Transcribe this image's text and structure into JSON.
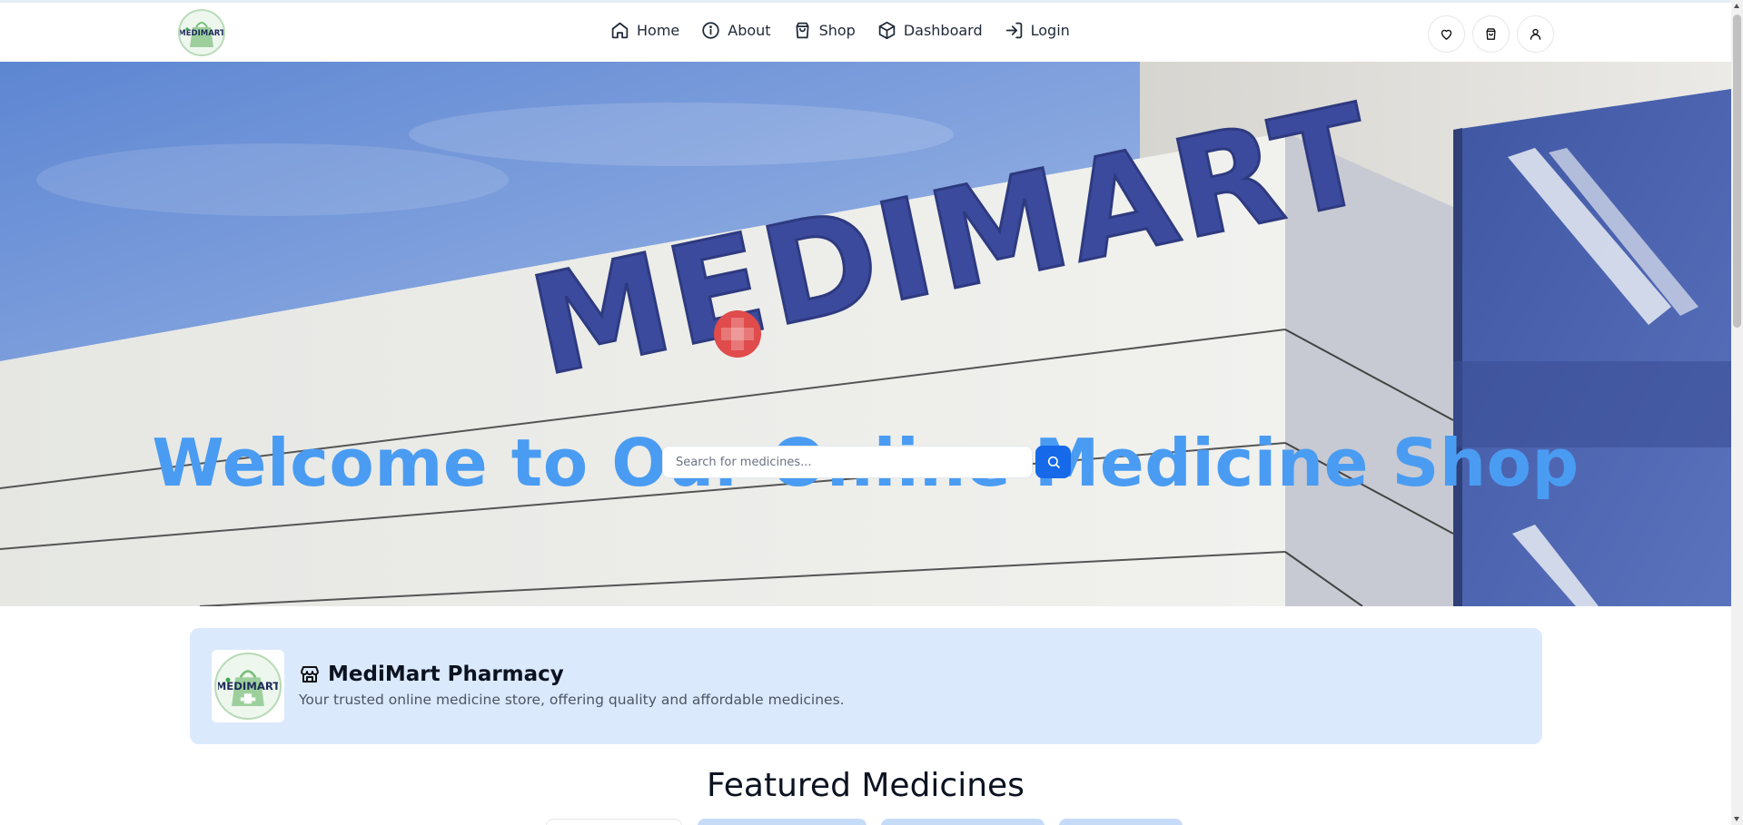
{
  "brand": {
    "logo_text": "MEDIMART",
    "logo_accent": "#3aaa48",
    "logo_dark": "#1d2b5a"
  },
  "nav": {
    "links": [
      {
        "label": "Home",
        "icon": "home-icon"
      },
      {
        "label": "About",
        "icon": "info-icon"
      },
      {
        "label": "Shop",
        "icon": "shopping-bag-icon"
      },
      {
        "label": "Dashboard",
        "icon": "package-icon"
      },
      {
        "label": "Login",
        "icon": "login-icon"
      }
    ],
    "actions": [
      {
        "icon": "heart-icon"
      },
      {
        "icon": "cart-icon"
      },
      {
        "icon": "user-icon"
      }
    ]
  },
  "hero": {
    "signage_text": "MEDIMART",
    "title": "Welcome to Our Online Medicine Shop",
    "search_placeholder": "Search for medicines...",
    "title_color": "#4a9cf2",
    "button_color": "#1669e8"
  },
  "store": {
    "name": "MediMart Pharmacy",
    "description": "Your trusted online medicine store, offering quality and affordable medicines.",
    "icon": "store-icon",
    "background": "#dbe9fd"
  },
  "featured": {
    "title": "Featured Medicines"
  }
}
